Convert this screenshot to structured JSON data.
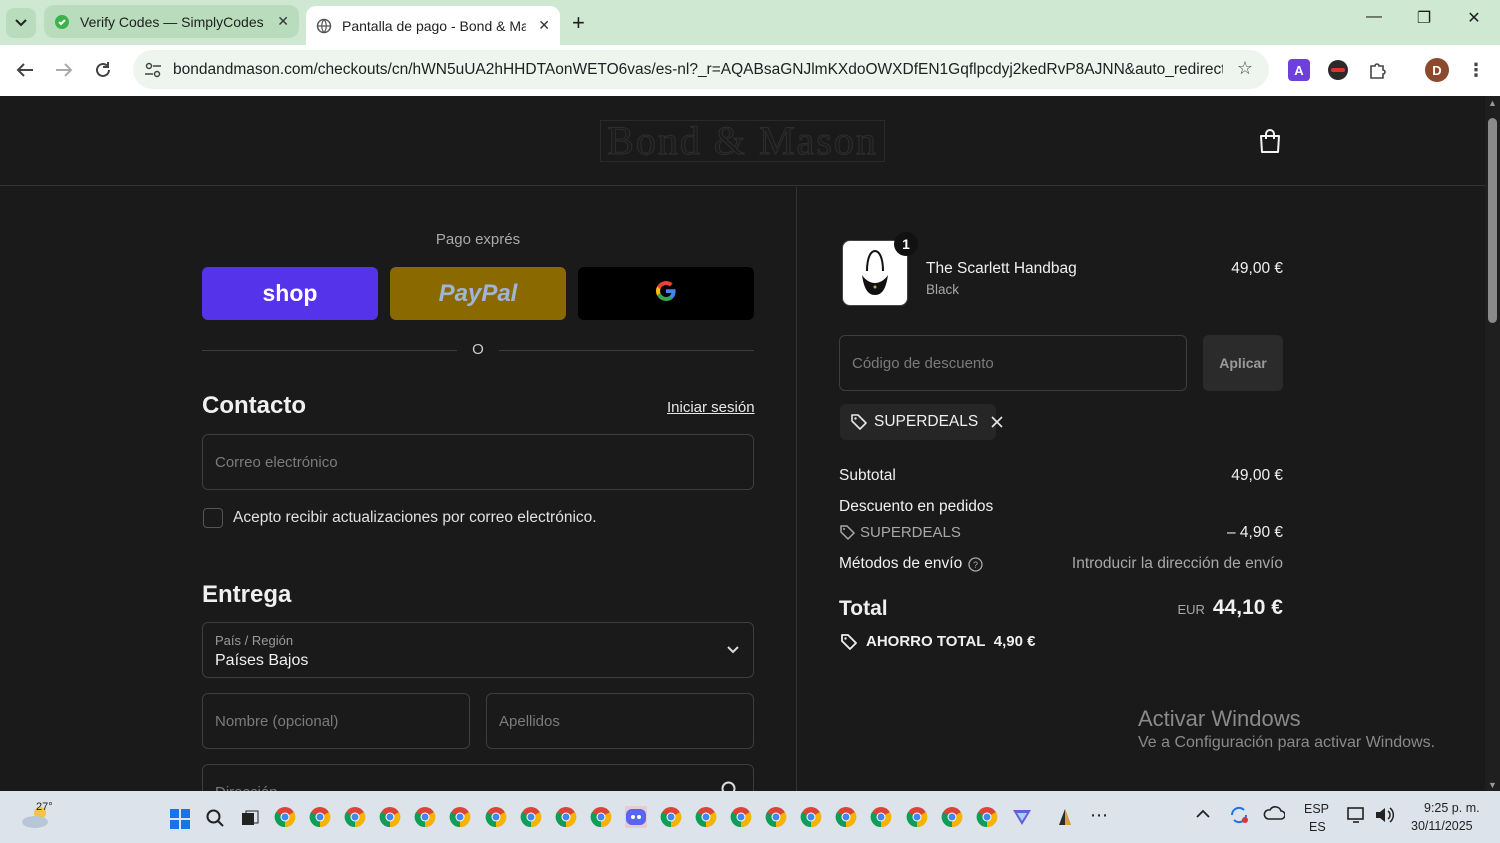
{
  "browser": {
    "tabs": [
      {
        "title": "Verify Codes — SimplyCodes",
        "active": false
      },
      {
        "title": "Pantalla de pago - Bond & Mas",
        "active": true
      }
    ],
    "url": "bondandmason.com/checkouts/cn/hWN5uUA2hHHDTAonWETO6vas/es-nl?_r=AQABsaGNJlmKXdoOWXDfEN1Gqflpcdyj2kedRvP8AJNN&auto_redirect=f...",
    "profile_initial": "D"
  },
  "header": {
    "logo": "Bond & Mason"
  },
  "express": {
    "label": "Pago exprés",
    "shop_label": "shop",
    "paypal_label": "PayPal",
    "google_label": "G",
    "or_label": "O"
  },
  "contact": {
    "title": "Contacto",
    "login_link": "Iniciar sesión",
    "email_placeholder": "Correo electrónico",
    "newsletter_label": "Acepto recibir actualizaciones por correo electrónico."
  },
  "delivery": {
    "title": "Entrega",
    "country_label": "País / Región",
    "country_value": "Países Bajos",
    "first_name_placeholder": "Nombre (opcional)",
    "last_name_placeholder": "Apellidos",
    "address_placeholder": "Dirección"
  },
  "summary": {
    "item": {
      "name": "The Scarlett Handbag",
      "variant": "Black",
      "price": "49,00 €",
      "quantity": "1"
    },
    "discount_placeholder": "Código de descuento",
    "apply_label": "Aplicar",
    "applied_code": "SUPERDEALS",
    "subtotal_label": "Subtotal",
    "subtotal_value": "49,00 €",
    "order_discount_label": "Descuento en pedidos",
    "discount_code": "SUPERDEALS",
    "discount_value": "– 4,90 €",
    "shipping_label": "Métodos de envío",
    "shipping_value": "Introducir la dirección de envío",
    "total_label": "Total",
    "total_currency": "EUR",
    "total_value": "44,10 €",
    "savings_label": "AHORRO TOTAL",
    "savings_value": "4,90 €"
  },
  "watermark": {
    "title": "Activar Windows",
    "subtitle": "Ve a Configuración para activar Windows."
  },
  "taskbar": {
    "weather_temp": "27°",
    "lang_top": "ESP",
    "lang_bottom": "ES",
    "time": "9:25 p. m.",
    "date": "30/11/2025"
  }
}
